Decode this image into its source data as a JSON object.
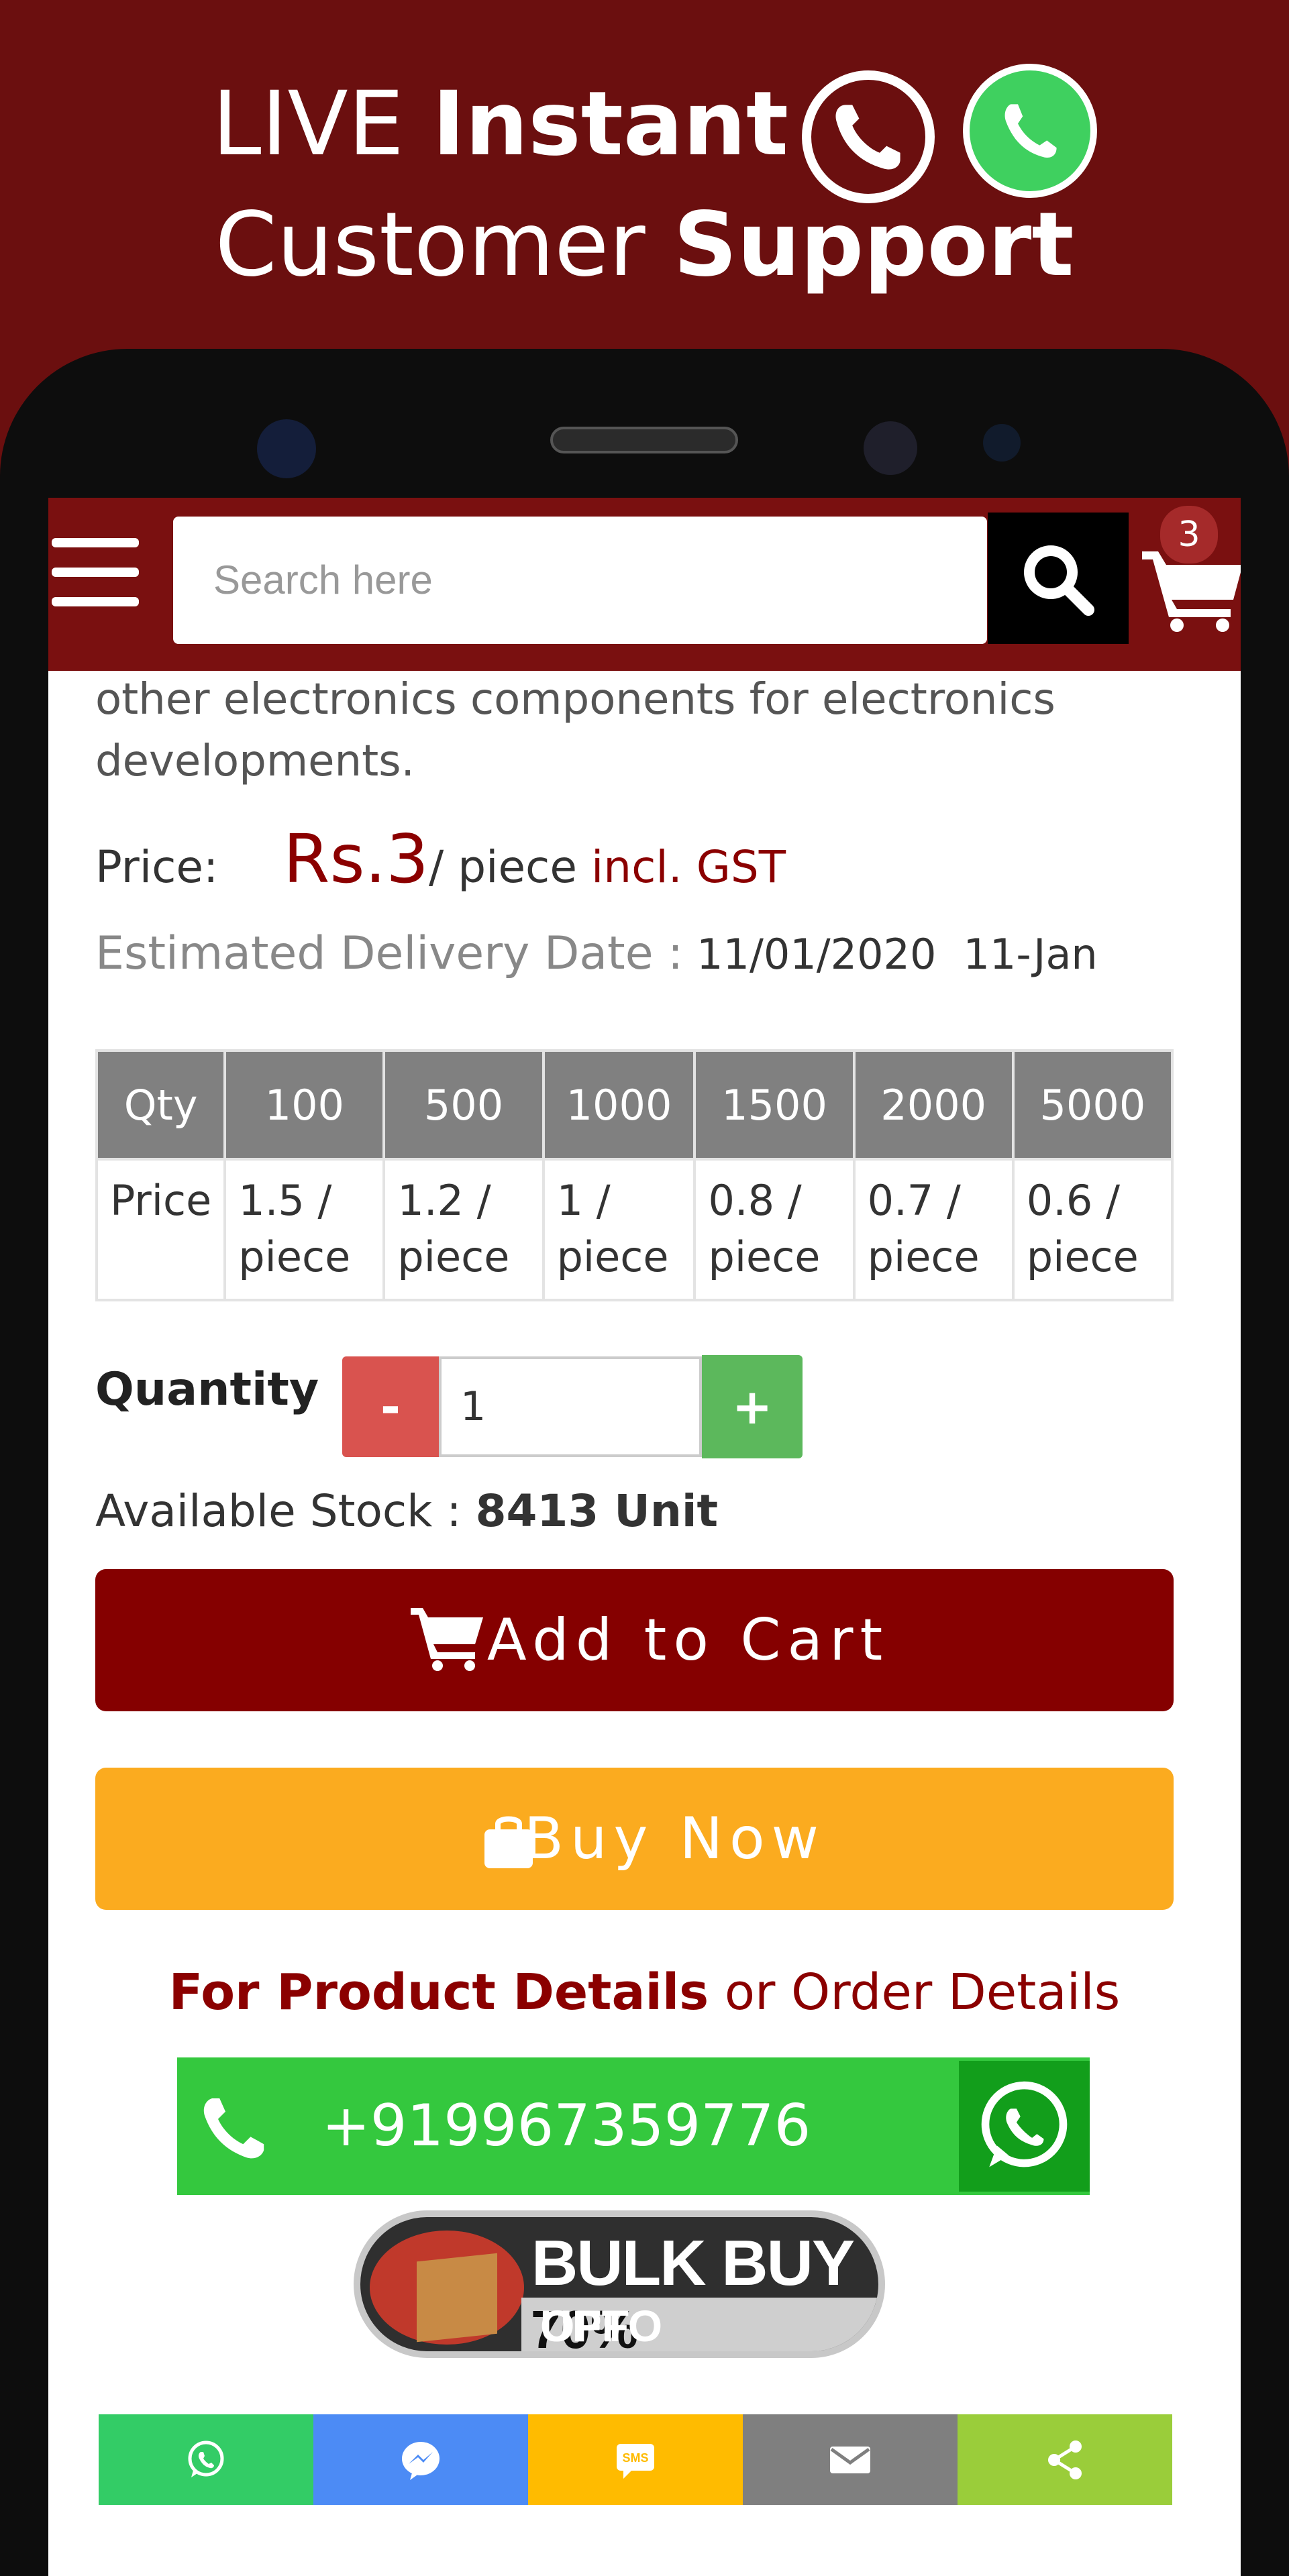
{
  "hero": {
    "line1_light": "LIVE ",
    "line1_bold": "Instant",
    "line2_light": "Customer ",
    "line2_bold": "Support"
  },
  "header": {
    "search_placeholder": "Search here",
    "cart_count": "3"
  },
  "product": {
    "description": "other electronics components for electronics developments.",
    "price_label": "Price:",
    "price_value": "Rs.3",
    "price_unit": "/ piece ",
    "price_tax_note": "incl. GST",
    "delivery_label": "Estimated Delivery Date :",
    "delivery_date": "11/01/2020",
    "delivery_day": "11-Jan"
  },
  "tier_table": {
    "qty_label": "Qty",
    "price_label": "Price",
    "quantities": [
      "100",
      "500",
      "1000",
      "1500",
      "2000",
      "5000"
    ],
    "prices": [
      "1.5 / piece",
      "1.2 / piece",
      "1 / piece",
      "0.8 / piece",
      "0.7 / piece",
      "0.6 / piece"
    ]
  },
  "quantity": {
    "label": "Quantity",
    "minus": "-",
    "value": "1",
    "plus": "+"
  },
  "stock": {
    "label": "Available Stock : ",
    "value": "8413 Unit"
  },
  "actions": {
    "add_to_cart": "Add to Cart",
    "buy_now": "Buy Now"
  },
  "contact": {
    "details_bold": "For Product Details",
    "details_rest": " or Order Details",
    "phone_number": "+919967359776"
  },
  "promo": {
    "title": "BULK BUY",
    "sub_prefix": "UPTO",
    "sub_percent": "70%",
    "sub_suffix": "OFF"
  },
  "share_bar": [
    {
      "icon": "whatsapp-icon",
      "color": "#33cc66"
    },
    {
      "icon": "messenger-icon",
      "color": "#4c8bf5"
    },
    {
      "icon": "sms-icon",
      "color": "#ffbb00",
      "text": "SMS"
    },
    {
      "icon": "email-icon",
      "color": "#7f7f7f"
    },
    {
      "icon": "share-icon",
      "color": "#9acd3a"
    }
  ],
  "colors": {
    "brand_maroon": "#6b0f0f",
    "add_to_cart_bg": "#850000",
    "buy_now_bg": "#fbab1f",
    "whatsapp_green": "#34c83e"
  }
}
